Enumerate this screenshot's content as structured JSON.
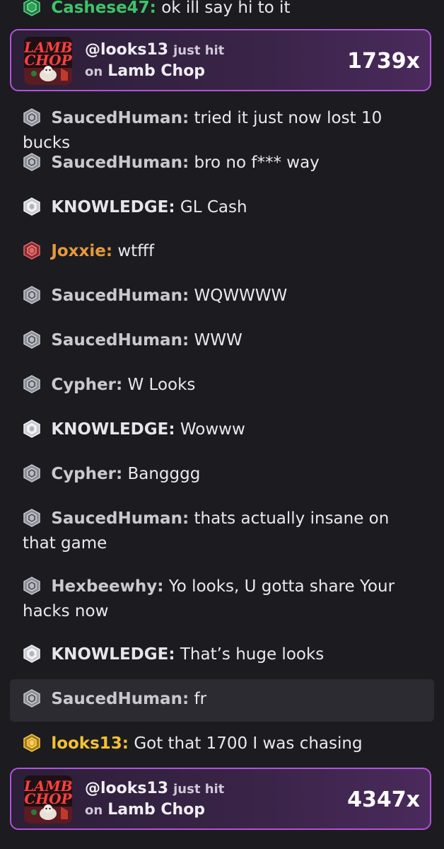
{
  "top_message": {
    "user": "Cashese47:",
    "text": "ok ill say hi to it",
    "badge": "emerald-badge"
  },
  "win_cards": [
    {
      "handle": "@looks13",
      "just_hit": "just hit",
      "on": "on",
      "game": "Lamb Chop",
      "multiplier": "1739x",
      "thumb_title": "LAMB",
      "thumb_sub": "CHOP"
    },
    {
      "handle": "@looks13",
      "just_hit": "just hit",
      "on": "on",
      "game": "Lamb Chop",
      "multiplier": "4347x",
      "thumb_title": "LAMB",
      "thumb_sub": "CHOP"
    }
  ],
  "messages": [
    {
      "user": "SaucedHuman:",
      "text": "tried it just now lost 10 bucks",
      "badge": "platinum-badge"
    },
    {
      "user": "SaucedHuman:",
      "text": "bro no f*** way",
      "badge": "platinum-badge"
    },
    {
      "user": "KNOWLEDGE:",
      "text": "GL Cash",
      "badge": "diamond-badge"
    },
    {
      "user": "Joxxie:",
      "text": "wtfff",
      "badge": "ruby-badge"
    },
    {
      "user": "SaucedHuman:",
      "text": "WQWWWW",
      "badge": "platinum-badge"
    },
    {
      "user": "SaucedHuman:",
      "text": "WWW",
      "badge": "platinum-badge"
    },
    {
      "user": "Cypher:",
      "text": "W Looks",
      "badge": "platinum-badge"
    },
    {
      "user": "KNOWLEDGE:",
      "text": "Wowww",
      "badge": "diamond-badge"
    },
    {
      "user": "Cypher:",
      "text": "Bangggg",
      "badge": "platinum-badge"
    },
    {
      "user": "SaucedHuman:",
      "text": "thats actually insane on that game",
      "badge": "platinum-badge"
    },
    {
      "user": "Hexbeewhy:",
      "text": "Yo looks, U gotta share Your hacks now",
      "badge": "platinum-badge"
    },
    {
      "user": "KNOWLEDGE:",
      "text": "That’s huge looks",
      "badge": "diamond-badge"
    },
    {
      "user": "SaucedHuman:",
      "text": "fr",
      "badge": "platinum-badge"
    },
    {
      "user": "looks13:",
      "text": "Got that 1700 I was chasing",
      "badge": "gold-badge"
    }
  ],
  "colors": {
    "background": "#1c1b20",
    "win_border": "#b054d6",
    "gold_user": "#f2c233",
    "orange_user": "#e59a3c",
    "green_user": "#3fc36a"
  }
}
